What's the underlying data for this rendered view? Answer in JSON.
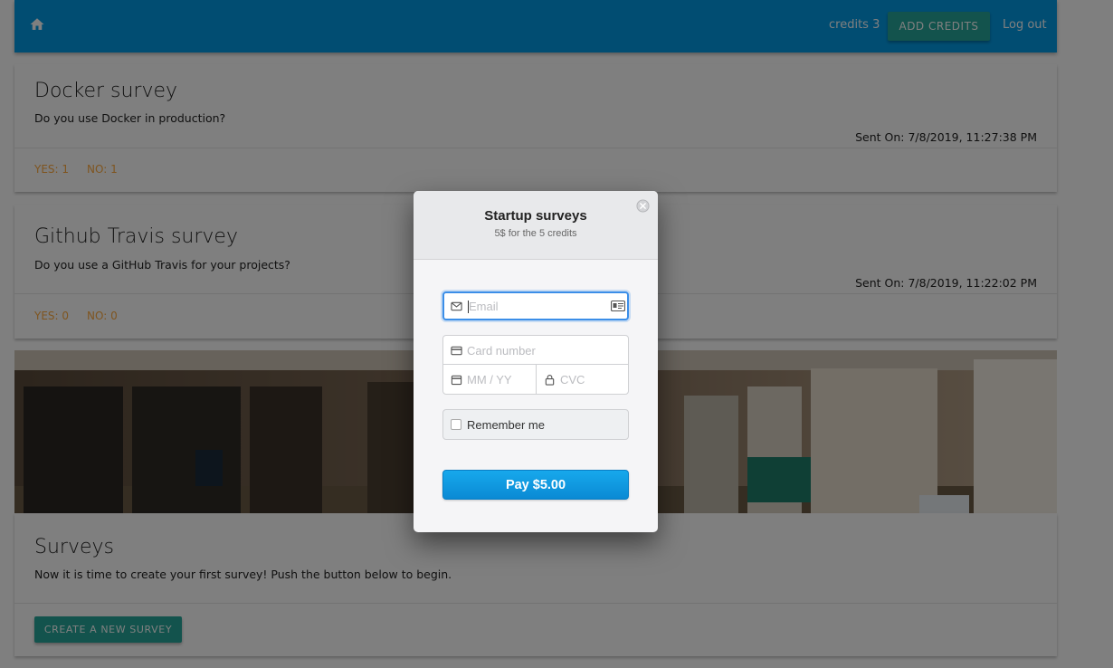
{
  "nav": {
    "credits": "credits 3",
    "add_credits": "ADD CREDITS",
    "logout": "Log out",
    "home_icon": "home-icon",
    "color": "#039be5"
  },
  "surveys": [
    {
      "title": "Docker survey",
      "question": "Do you use Docker in production?",
      "sent": "Sent On: 7/8/2019, 11:27:38 PM",
      "yes": "YES: 1",
      "no": "NO: 1"
    },
    {
      "title": "Github Travis survey",
      "question": "Do you use a GitHub Travis for your projects?",
      "sent": "Sent On: 7/8/2019, 11:22:02 PM",
      "yes": "YES: 0",
      "no": "NO: 0"
    }
  ],
  "intro": {
    "title": "Surveys",
    "text": "Now it is time to create your first survey! Push the button below to begin.",
    "button": "CREATE A NEW SURVEY"
  },
  "checkout": {
    "title": "Startup surveys",
    "subtitle": "5$ for the 5 credits",
    "email_placeholder": "Email",
    "card_placeholder": "Card number",
    "expiry_placeholder": "MM / YY",
    "cvc_placeholder": "CVC",
    "remember_label": "Remember me",
    "pay_label": "Pay $5.00",
    "pay_color": "#0a8ad4"
  }
}
